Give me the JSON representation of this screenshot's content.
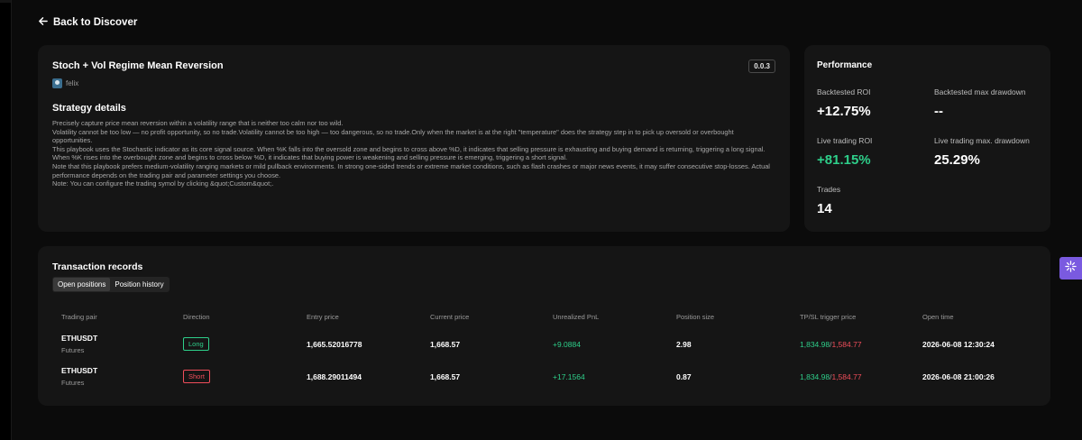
{
  "nav": {
    "back_label": "Back to Discover"
  },
  "strategy": {
    "title": "Stoch + Vol Regime Mean Reversion",
    "version": "0.0.3",
    "author": "felix",
    "details_heading": "Strategy details",
    "description": [
      "Precisely capture price mean reversion within a volatility range that is neither too calm nor too wild.",
      "Volatility cannot be too low — no profit opportunity, so no trade.Volatility cannot be too high — too dangerous, so no trade.Only when the market is at the right \"temperature\" does the strategy step in to pick up oversold or overbought opportunities.",
      "This playbook uses the Stochastic indicator as its core signal source. When %K falls into the oversold zone and begins to cross above %D, it indicates that selling pressure is exhausting and buying demand is returning, triggering a long signal. When %K rises into the overbought zone and begins to cross below %D, it indicates that buying power is weakening and selling pressure is emerging, triggering a short signal.",
      "Note that this playbook prefers medium-volatility ranging markets or mild pullback environments. In strong one-sided trends or extreme market conditions, such as flash crashes or major news events, it may suffer consecutive stop-losses. Actual performance depends on the trading pair and parameter settings you choose.",
      "Note: You can configure the trading symol by clicking &quot;Custom&quot;."
    ]
  },
  "performance": {
    "title": "Performance",
    "backtested_roi_label": "Backtested ROI",
    "backtested_roi": "+12.75%",
    "backtested_dd_label": "Backtested max drawdown",
    "backtested_dd": "--",
    "live_roi_label": "Live trading ROI",
    "live_roi": "+81.15%",
    "live_dd_label": "Live trading max. drawdown",
    "live_dd": "25.29%",
    "trades_label": "Trades",
    "trades": "14"
  },
  "transactions": {
    "title": "Transaction records",
    "tabs": [
      "Open positions",
      "Position history"
    ],
    "active_tab": "Open positions",
    "columns": [
      "Trading pair",
      "Direction",
      "Entry price",
      "Current price",
      "Unrealized PnL",
      "Position size",
      "TP/SL trigger price",
      "Open time"
    ],
    "rows": [
      {
        "pair": "ETHUSDT",
        "market": "Futures",
        "direction": "Long",
        "entry": "1,665.52016778",
        "current": "1,668.57",
        "pnl": "+9.0884",
        "size": "2.98",
        "tp": "1,834.98",
        "sl": "1,584.77",
        "open_time": "2026-06-08 12:30:24"
      },
      {
        "pair": "ETHUSDT",
        "market": "Futures",
        "direction": "Short",
        "entry": "1,688.29011494",
        "current": "1,668.57",
        "pnl": "+17.1564",
        "size": "0.87",
        "tp": "1,834.98",
        "sl": "1,584.77",
        "open_time": "2026-06-08 21:00:26"
      }
    ]
  },
  "colors": {
    "positive": "#2ecf8a",
    "negative": "#ef4d5a",
    "widget": "#7a5ae0"
  },
  "icons": {
    "back": "arrow-left-icon",
    "side_widget": "sparkle-icon"
  }
}
